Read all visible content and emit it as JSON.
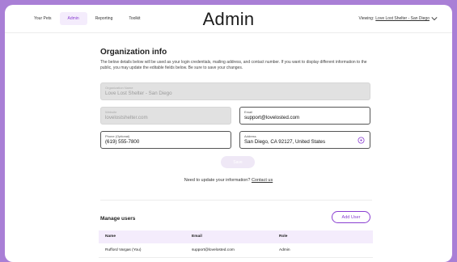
{
  "nav": {
    "tabs": [
      {
        "label": "Your Pets"
      },
      {
        "label": "Admin"
      },
      {
        "label": "Reporting"
      },
      {
        "label": "Toolkit"
      }
    ],
    "title": "Admin",
    "viewing_prefix": "Viewing:",
    "viewing_org": "Love Lost Shelter - San Diego"
  },
  "org": {
    "heading": "Organization info",
    "description": "The below details below will be used as your login credentials, mailing address, and contact number. If you want to display different information to the public, you may update the editable fields below. Be sure to save your changes.",
    "name": {
      "label": "Organization Name",
      "value": "Love Lost Shelter - San Diego"
    },
    "website": {
      "label": "Website",
      "value": "lovelostshelter.com"
    },
    "email": {
      "label": "Email",
      "value": "support@lovelosted.com"
    },
    "phone": {
      "label": "Phone (Optional)",
      "value": "(619) 555-7800"
    },
    "address": {
      "label": "Address",
      "value": "San Diego, CA 92127, United States"
    },
    "save_label": "Save",
    "update_text": "Need to update your information?",
    "contact_link": "Contact us"
  },
  "users": {
    "heading": "Manage users",
    "add_label": "Add User",
    "columns": [
      "Name",
      "Email",
      "Role"
    ],
    "rows": [
      {
        "name": "Rufford Vargas (You)",
        "email": "support@lovelosted.com",
        "role": "Admin"
      }
    ]
  },
  "colors": {
    "accent": "#8a3fd1",
    "frame_bg": "#a97fd6"
  }
}
